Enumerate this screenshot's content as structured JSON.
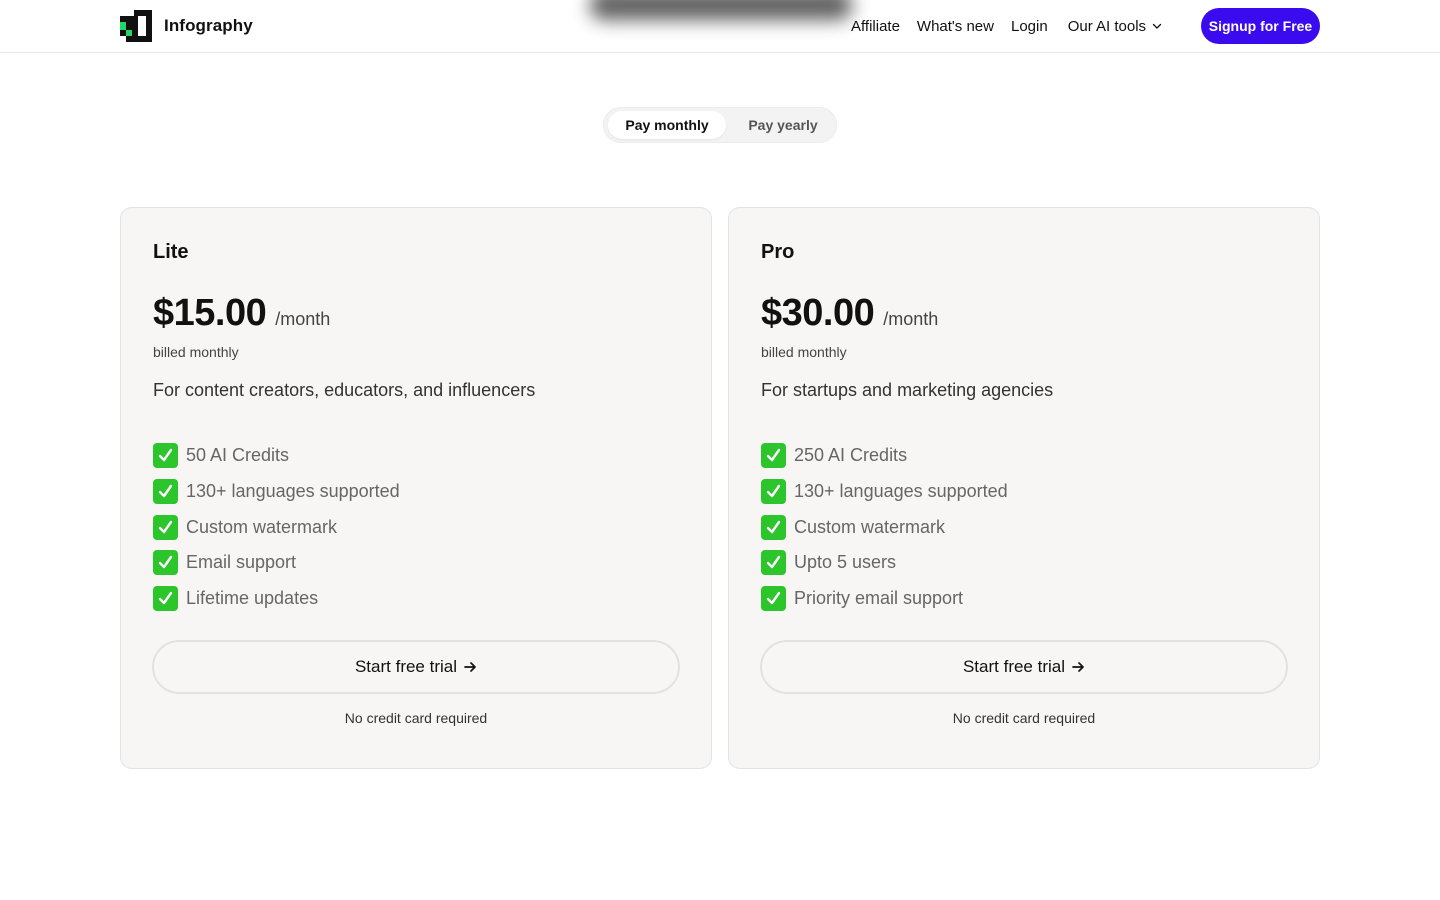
{
  "header": {
    "brand": "Infography",
    "nav": {
      "affiliate": "Affiliate",
      "whats_new": "What's new",
      "login": "Login",
      "ai_tools": "Our AI tools"
    },
    "signup_label": "Signup for Free",
    "signup_color": "#3b0bf0"
  },
  "billing_toggle": {
    "monthly": "Pay monthly",
    "yearly": "Pay yearly",
    "selected": "monthly"
  },
  "plans": [
    {
      "name": "Lite",
      "price": "$15.00",
      "period": "/month",
      "billed": "billed monthly",
      "description": "For content creators, educators, and influencers",
      "features": [
        "50 AI Credits",
        "130+ languages supported",
        "Custom watermark",
        "Email support",
        "Lifetime updates"
      ],
      "cta": "Start free trial",
      "note": "No credit card required"
    },
    {
      "name": "Pro",
      "price": "$30.00",
      "period": "/month",
      "billed": "billed monthly",
      "description": "For startups and marketing agencies",
      "features": [
        "250 AI Credits",
        "130+ languages supported",
        "Custom watermark",
        "Upto 5 users",
        "Priority email support"
      ],
      "cta": "Start free trial",
      "note": "No credit card required"
    }
  ],
  "icons": {
    "check": "check-mark-icon",
    "arrow": "arrow-right-icon",
    "chevron": "chevron-down-icon"
  },
  "colors": {
    "check_green": "#2cc52c",
    "logo_green": "#22d66a"
  }
}
